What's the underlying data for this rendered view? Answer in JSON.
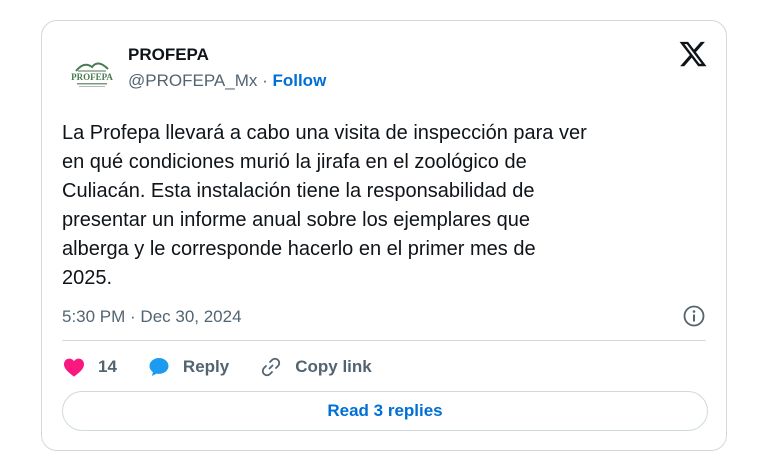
{
  "account": {
    "name": "PROFEPA",
    "handle": "@PROFEPA_Mx",
    "separator": " · ",
    "follow_label": "Follow",
    "avatar_text": "PROFEPA"
  },
  "tweet": {
    "text": "La Profepa llevará a cabo una visita de inspección para ver\nen qué condiciones murió la jirafa en el zoológico de\nCuliacán. Esta instalación tiene la responsabilidad de\npresentar un informe anual sobre los ejemplares que\nalberga y le corresponde hacerlo en el primer mes de\n2025.",
    "timestamp": "5:30 PM · Dec 30, 2024"
  },
  "actions": {
    "like_count": "14",
    "reply_label": "Reply",
    "copy_link_label": "Copy link"
  },
  "read_replies_label": "Read 3 replies",
  "colors": {
    "accent": "#006fd6",
    "like": "#f91880",
    "reply_icon": "#1d9bf0",
    "muted": "#536471",
    "border": "#cfd9de"
  },
  "icons": [
    "x-logo-icon",
    "info-icon",
    "heart-icon",
    "reply-bubble-icon",
    "link-icon"
  ]
}
